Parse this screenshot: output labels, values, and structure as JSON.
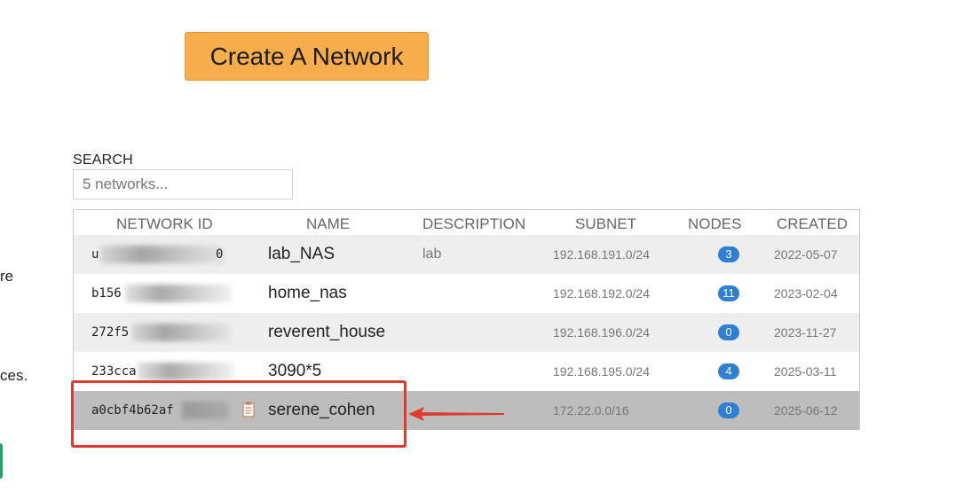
{
  "left_fragments": [
    "re",
    "ces."
  ],
  "create_button": {
    "label": "Create A Network"
  },
  "search": {
    "label": "SEARCH",
    "placeholder": "5 networks..."
  },
  "table": {
    "headers": [
      "NETWORK ID",
      "NAME",
      "DESCRIPTION",
      "SUBNET",
      "NODES",
      "CREATED"
    ],
    "rows": [
      {
        "id_visible": "u",
        "id_tail": "0",
        "name": "lab_NAS",
        "description": "lab",
        "subnet": "192.168.191.0/24",
        "nodes": "3",
        "created": "2022-05-07"
      },
      {
        "id_visible": "b156",
        "id_tail": "",
        "name": "home_nas",
        "description": "",
        "subnet": "192.168.192.0/24",
        "nodes": "11",
        "created": "2023-02-04"
      },
      {
        "id_visible": "272f5",
        "id_tail": "",
        "name": "reverent_house",
        "description": "",
        "subnet": "192.168.196.0/24",
        "nodes": "0",
        "created": "2023-11-27"
      },
      {
        "id_visible": "233cca",
        "id_tail": "",
        "name": "3090*5",
        "description": "",
        "subnet": "192.168.195.0/24",
        "nodes": "4",
        "created": "2025-03-11"
      },
      {
        "id_visible": "a0cbf4b62af",
        "id_tail": "",
        "name": "serene_cohen",
        "description": "",
        "subnet": "172.22.0.0/16",
        "nodes": "0",
        "created": "2025-06-12"
      }
    ]
  },
  "colors": {
    "button": "#f7ad4a",
    "badge": "#2f7fd6",
    "selected_row": "#bdbdbd",
    "annotation": "#e03a2f"
  }
}
